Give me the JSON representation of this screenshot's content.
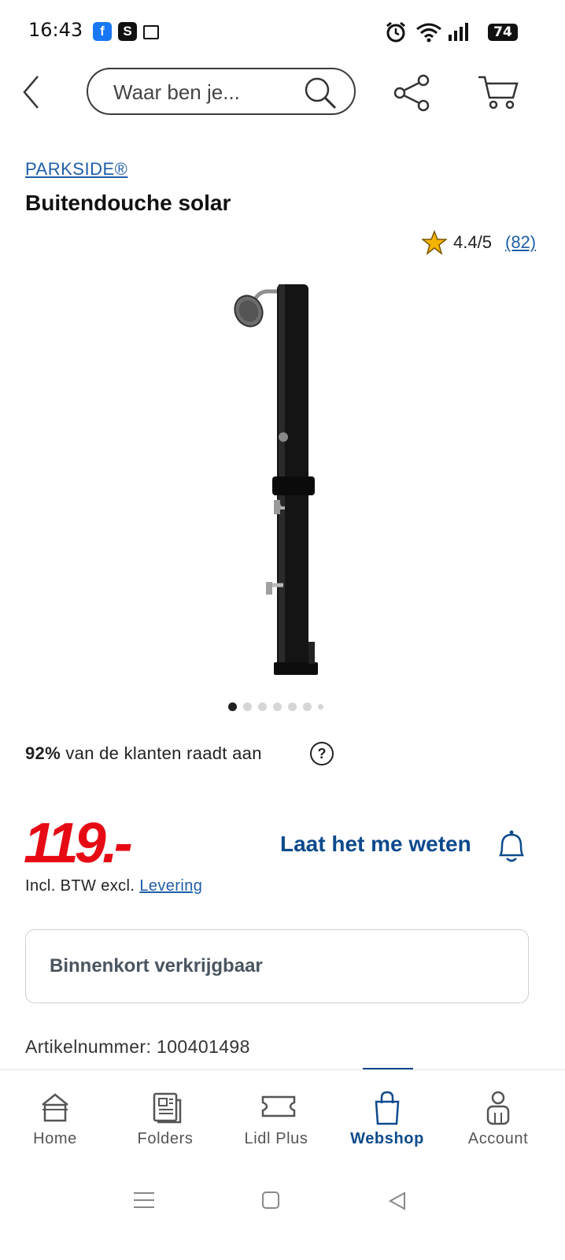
{
  "status_bar": {
    "time": "16:43",
    "badges": [
      "facebook-icon",
      "s-app-icon",
      "calendar-icon"
    ],
    "s_letter": "S",
    "fb_letter": "f",
    "battery": "74"
  },
  "header": {
    "search_placeholder": "Waar ben je..."
  },
  "product": {
    "brand": "PARKSIDE®",
    "title": "Buitendouche solar",
    "rating": "4.4/5",
    "rating_count": "(82)",
    "recommend_percent": "92%",
    "recommend_text": "van de klanten raadt aan",
    "help_symbol": "?",
    "price": "119.-",
    "notify_label": "Laat het me weten",
    "vat_text": "Incl. BTW excl.",
    "vat_link": "Levering",
    "availability": "Binnenkort verkrijgbaar",
    "article_label": "Artikelnummer:",
    "article_number": "100401498",
    "gallery_images": 7,
    "gallery_active": 1
  },
  "bottom_nav": {
    "items": [
      {
        "label": "Home",
        "icon": "home-icon"
      },
      {
        "label": "Folders",
        "icon": "folder-leaflet-icon"
      },
      {
        "label": "Lidl Plus",
        "icon": "ticket-icon"
      },
      {
        "label": "Webshop",
        "icon": "shopping-bag-icon",
        "active": true
      },
      {
        "label": "Account",
        "icon": "user-icon"
      }
    ]
  },
  "colors": {
    "brand_blue": "#0d4a8c",
    "link_blue": "#1f5ea8",
    "price_red": "#e60a14",
    "rating_star": "#f5b400"
  }
}
